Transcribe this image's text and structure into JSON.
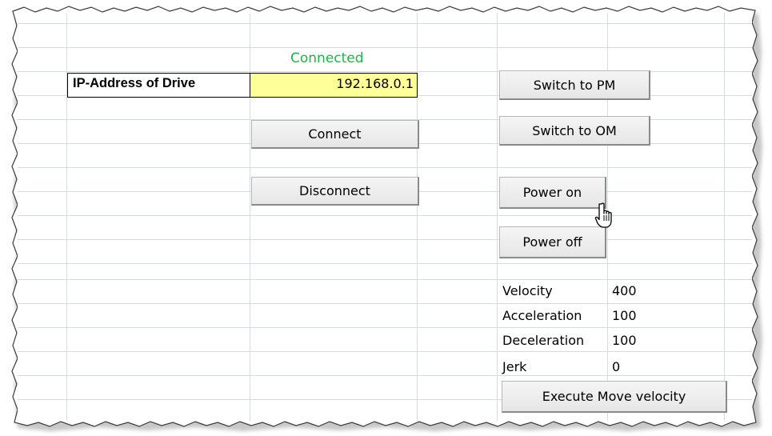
{
  "status": {
    "text": "Connected",
    "color": "#21b24a"
  },
  "ip_address": {
    "label": "IP-Address of Drive",
    "value": "192.168.0.1"
  },
  "buttons": {
    "connect": "Connect",
    "disconnect": "Disconnect",
    "switch_pm": "Switch to PM",
    "switch_om": "Switch to OM",
    "power_on": "Power on",
    "power_off": "Power off",
    "execute_move_velocity": "Execute Move velocity"
  },
  "parameters": [
    {
      "label": "Velocity",
      "value": "400"
    },
    {
      "label": "Acceleration",
      "value": "100"
    },
    {
      "label": "Deceleration",
      "value": "100"
    },
    {
      "label": "Jerk",
      "value": "0"
    }
  ],
  "cursor": {
    "icon": "hand-pointer-icon"
  },
  "colors": {
    "gridline": "#d6dbe3",
    "value_fill": "#ffff99",
    "status": "#21b24a"
  }
}
